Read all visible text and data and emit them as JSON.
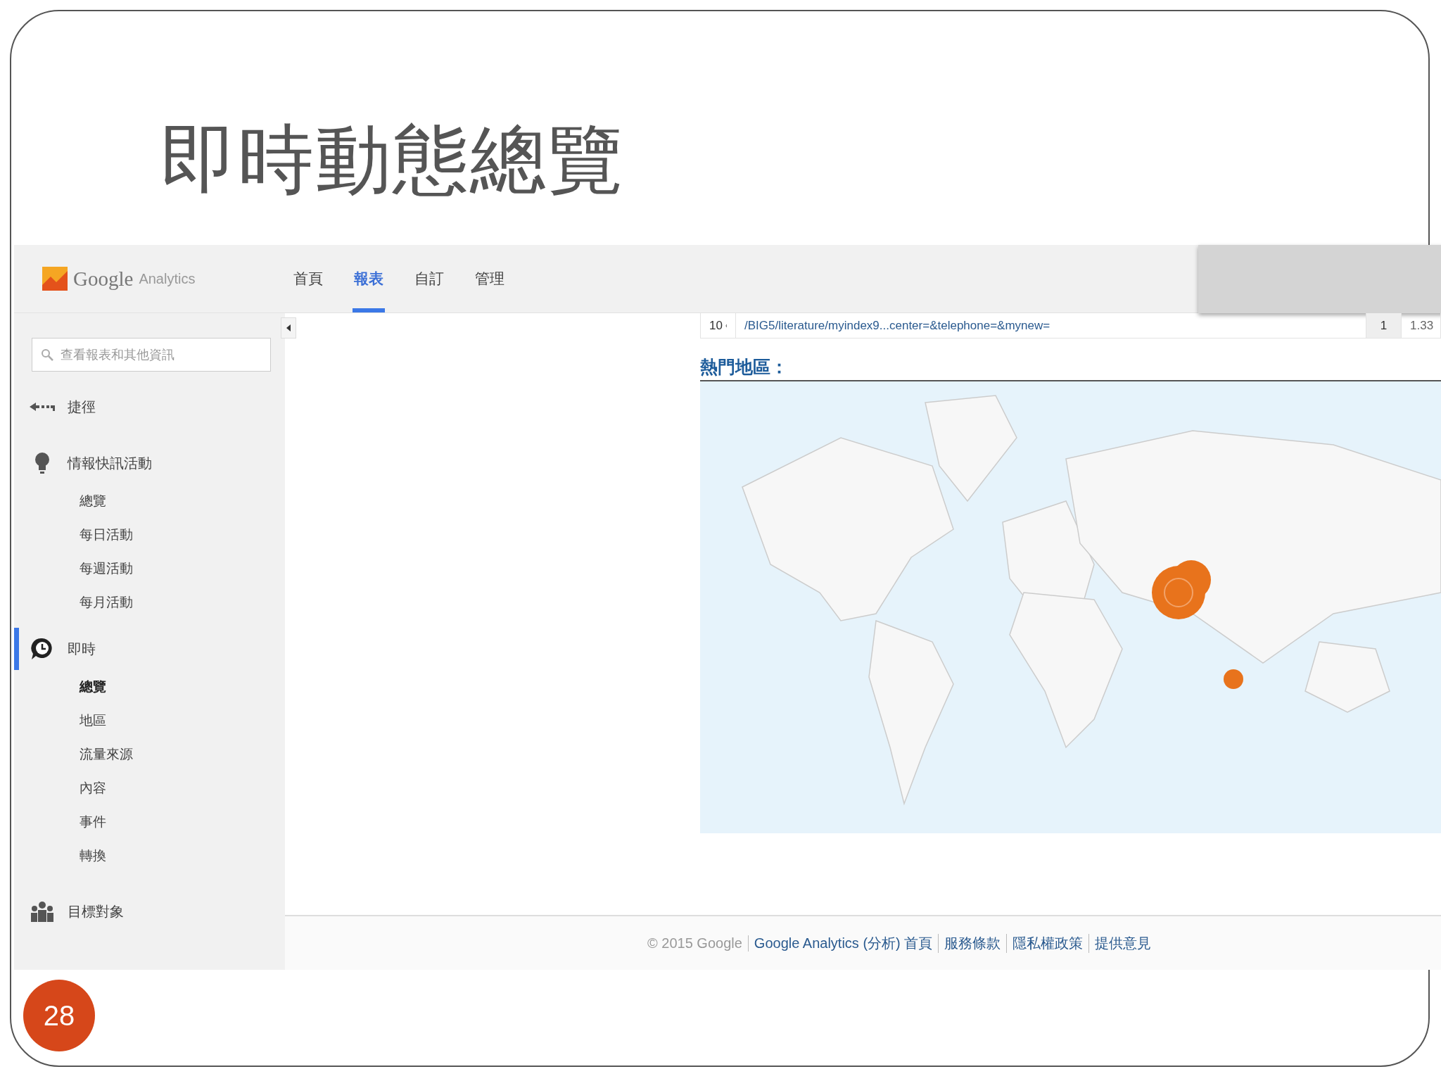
{
  "slide": {
    "title": "即時動態總覽",
    "page_number": "28"
  },
  "app": {
    "logo": {
      "brand": "Google",
      "product": "Analytics"
    },
    "nav_tabs": [
      {
        "label": "首頁",
        "selected": false
      },
      {
        "label": "報表",
        "selected": true
      },
      {
        "label": "自訂",
        "selected": false
      },
      {
        "label": "管理",
        "selected": false
      }
    ],
    "search": {
      "placeholder": "查看報表和其他資訊"
    },
    "sidebar": [
      {
        "kind": "shortcut",
        "label": "捷徑",
        "selected": false
      },
      {
        "kind": "insights",
        "label": "情報快訊活動",
        "selected": false,
        "children": [
          {
            "label": "總覽",
            "selected": false
          },
          {
            "label": "每日活動",
            "selected": false
          },
          {
            "label": "每週活動",
            "selected": false
          },
          {
            "label": "每月活動",
            "selected": false
          }
        ]
      },
      {
        "kind": "realtime",
        "label": "即時",
        "selected": true,
        "children": [
          {
            "label": "總覽",
            "selected": true
          },
          {
            "label": "地區",
            "selected": false
          },
          {
            "label": "流量來源",
            "selected": false
          },
          {
            "label": "內容",
            "selected": false
          },
          {
            "label": "事件",
            "selected": false
          },
          {
            "label": "轉換",
            "selected": false
          }
        ]
      },
      {
        "kind": "audience",
        "label": "目標對象",
        "selected": false
      }
    ],
    "table_row": {
      "rank": "10",
      "url": "/BIG5/literature/myindex9...center=&telephone=&mynew=",
      "count": "1",
      "share": "1.33"
    },
    "section_heading": "熱門地區：",
    "footer": {
      "copyright": "© 2015 Google",
      "links": [
        "Google Analytics (分析) 首頁",
        "服務條款",
        "隱私權政策",
        "提供意見"
      ]
    }
  }
}
